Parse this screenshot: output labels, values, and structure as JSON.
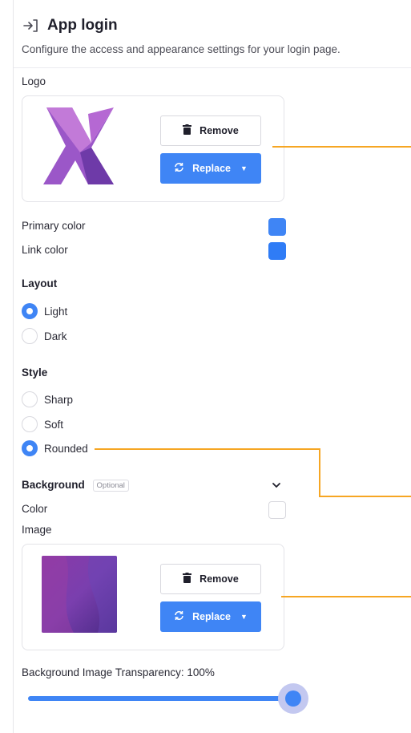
{
  "header": {
    "title": "App login",
    "subtitle": "Configure the access and appearance settings for your login page."
  },
  "logo": {
    "label": "Logo",
    "remove_label": "Remove",
    "replace_label": "Replace"
  },
  "colors": {
    "primary_label": "Primary color",
    "primary_value": "#3f85f5",
    "link_label": "Link color",
    "link_value": "#2f7cf6"
  },
  "layout": {
    "title": "Layout",
    "options": [
      {
        "label": "Light",
        "checked": true
      },
      {
        "label": "Dark",
        "checked": false
      }
    ]
  },
  "style": {
    "title": "Style",
    "options": [
      {
        "label": "Sharp",
        "checked": false
      },
      {
        "label": "Soft",
        "checked": false
      },
      {
        "label": "Rounded",
        "checked": true
      }
    ]
  },
  "background": {
    "title": "Background",
    "badge": "Optional",
    "color_label": "Color",
    "image_label": "Image",
    "remove_label": "Remove",
    "replace_label": "Replace",
    "transparency_label": "Background Image Transparency: 100%",
    "transparency_value": 1.0
  },
  "accent_color": "#3f85f5",
  "callout_color": "#f6a623"
}
